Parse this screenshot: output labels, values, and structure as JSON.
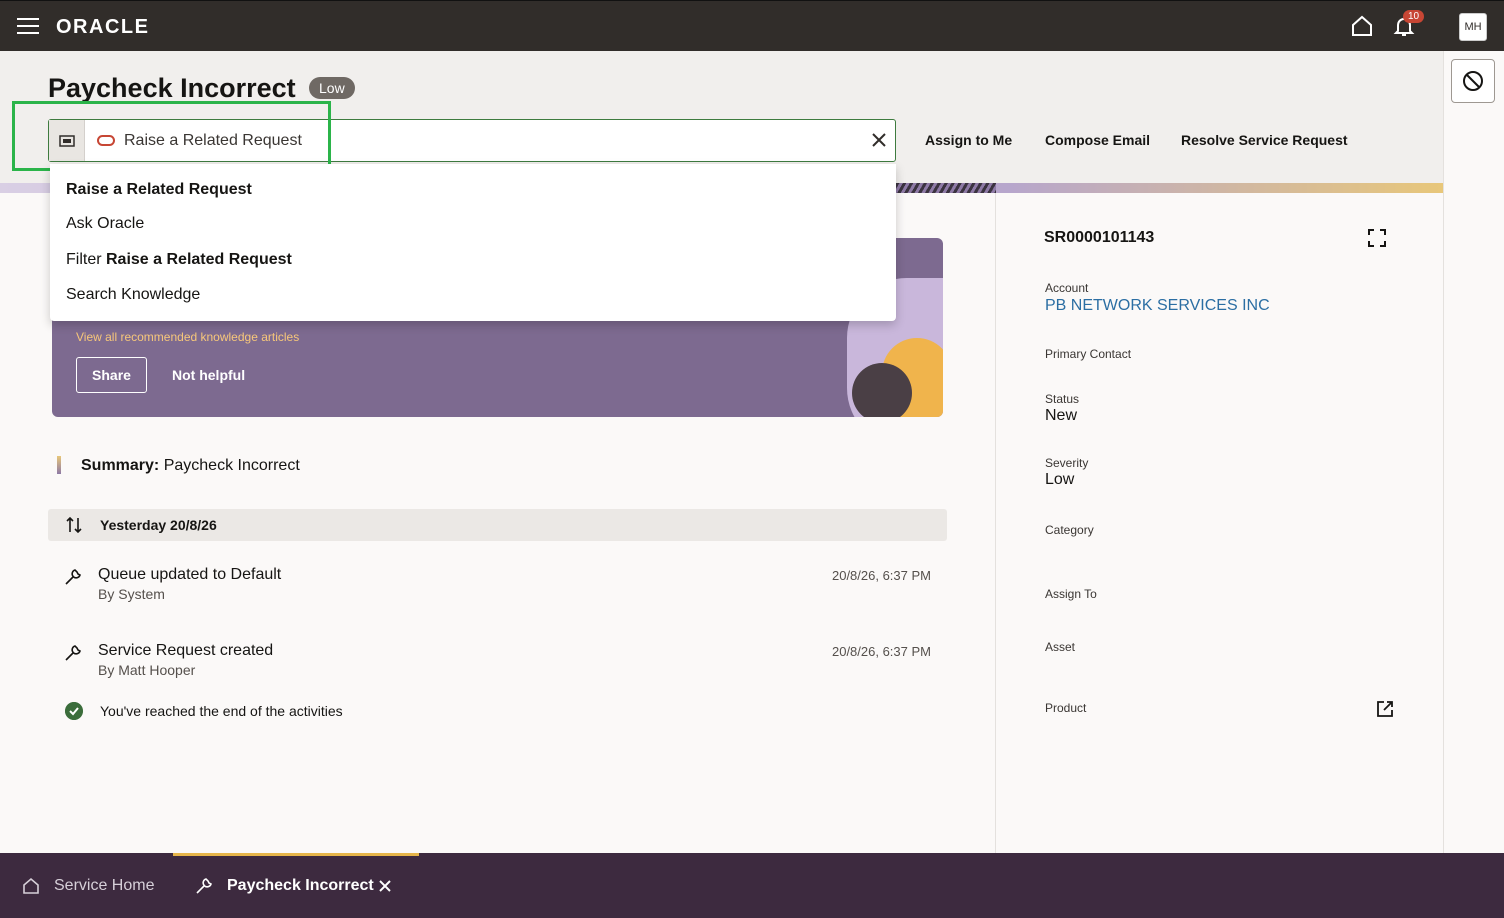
{
  "topbar": {
    "logo": "ORACLE",
    "notification_count": "10",
    "avatar_initials": "MH"
  },
  "header": {
    "title": "Paycheck Incorrect",
    "severity_badge": "Low"
  },
  "search": {
    "query": "Raise a Related Request"
  },
  "actions": {
    "assign_to_me": "Assign to Me",
    "compose_email": "Compose Email",
    "resolve": "Resolve Service Request"
  },
  "dropdown": {
    "item1": "Raise a Related Request",
    "item2": "Ask Oracle",
    "item3_prefix": "Filter ",
    "item3_bold": "Raise a Related Request",
    "item4": "Search Knowledge"
  },
  "knowledge_card": {
    "link": "View all recommended knowledge articles",
    "share": "Share",
    "not_helpful": "Not helpful"
  },
  "summary": {
    "label": "Summary:",
    "value": "Paycheck Incorrect"
  },
  "activity": {
    "day_label": "Yesterday 20/8/26",
    "items": [
      {
        "title": "Queue updated to Default",
        "by": "By System",
        "time": "20/8/26, 6:37 PM"
      },
      {
        "title": "Service Request created",
        "by": "By Matt Hooper",
        "time": "20/8/26, 6:37 PM"
      }
    ],
    "end_text": "You've reached the end of the activities"
  },
  "details": {
    "sr_number": "SR0000101143",
    "account_label": "Account",
    "account_value": "PB NETWORK SERVICES INC",
    "primary_contact_label": "Primary Contact",
    "status_label": "Status",
    "status_value": "New",
    "severity_label": "Severity",
    "severity_value": "Low",
    "category_label": "Category",
    "assign_to_label": "Assign To",
    "asset_label": "Asset",
    "product_label": "Product"
  },
  "bottom_tabs": {
    "home": "Service Home",
    "active": "Paycheck Incorrect"
  },
  "colors": {
    "topbar": "#312d2a",
    "accent_red": "#c74634",
    "link_blue": "#2b6ea3",
    "card_purple": "#7d6a90",
    "tabbar": "#3d2a3f",
    "highlight_green": "#2bb44a"
  }
}
